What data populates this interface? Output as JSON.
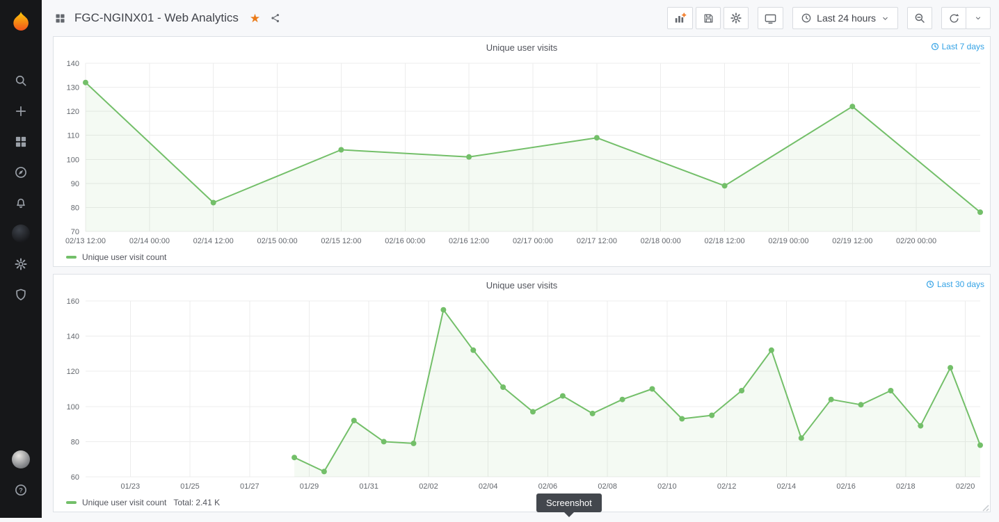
{
  "colors": {
    "accent_green": "#73bf69",
    "link_blue": "#33a2e5",
    "star_orange": "#eb7b18",
    "sidebar_bg": "#161719",
    "panel_bg": "#ffffff"
  },
  "sidebar": {
    "top_icons": [
      "grafana-logo",
      "search",
      "add",
      "dashboards",
      "explore-compass",
      "alerting-bell",
      "org-avatar",
      "configuration-gear",
      "server-admin-shield"
    ],
    "bottom_icons": [
      "user-avatar",
      "help"
    ]
  },
  "topbar": {
    "dashboard_icon": "apps",
    "title": "FGC-NGINX01 - Web Analytics",
    "star_icon": "star-filled",
    "share_icon": "share",
    "toolbar_icons": [
      "add-panel",
      "save",
      "settings-gear",
      "cycle-view-tv",
      "clock",
      "chevron-down",
      "zoom-out",
      "refresh"
    ],
    "time_picker_label": "Last 24 hours"
  },
  "tooltip": {
    "label": "Screenshot"
  },
  "chart_data": [
    {
      "type": "area",
      "title": "Unique user visits",
      "time_range_link": "Last 7 days",
      "legend_label": "Unique user visit count",
      "legend_total": "",
      "ylim": [
        70,
        140
      ],
      "y_ticks": [
        70,
        80,
        90,
        100,
        110,
        120,
        130,
        140
      ],
      "x_domain": [
        12,
        180
      ],
      "x_ticks": [
        "02/13 12:00",
        "02/14 00:00",
        "02/14 12:00",
        "02/15 00:00",
        "02/15 12:00",
        "02/16 00:00",
        "02/16 12:00",
        "02/17 00:00",
        "02/17 12:00",
        "02/18 00:00",
        "02/18 12:00",
        "02/19 00:00",
        "02/19 12:00",
        "02/20 00:00"
      ],
      "x_tick_pos": [
        12,
        24,
        36,
        48,
        60,
        72,
        84,
        96,
        108,
        120,
        132,
        144,
        156,
        168
      ],
      "point_dates": [
        "02/13 12:00",
        "02/14 12:00",
        "02/15 12:00",
        "02/16 12:00",
        "02/17 12:00",
        "02/18 12:00",
        "02/19 12:00",
        "02/20 12:00"
      ],
      "point_pos": [
        12,
        36,
        60,
        84,
        108,
        132,
        156,
        180
      ],
      "values": [
        132,
        82,
        104,
        101,
        109,
        89,
        122,
        78
      ],
      "grid": true,
      "legend_position": "bottom-left"
    },
    {
      "type": "area",
      "title": "Unique user visits",
      "time_range_link": "Last 30 days",
      "legend_label": "Unique user visit count",
      "legend_total": "Total: 2.41 K",
      "ylim": [
        60,
        160
      ],
      "y_ticks": [
        60,
        80,
        100,
        120,
        140,
        160
      ],
      "x_domain": [
        0.5,
        30.5
      ],
      "x_ticks": [
        "01/23",
        "01/25",
        "01/27",
        "01/29",
        "01/31",
        "02/02",
        "02/04",
        "02/06",
        "02/08",
        "02/10",
        "02/12",
        "02/14",
        "02/16",
        "02/18",
        "02/20"
      ],
      "x_tick_pos": [
        2,
        4,
        6,
        8,
        10,
        12,
        14,
        16,
        18,
        20,
        22,
        24,
        26,
        28,
        30
      ],
      "point_dates": [
        "01/28",
        "01/29",
        "01/30",
        "01/31",
        "02/01",
        "02/02",
        "02/03",
        "02/04",
        "02/05",
        "02/06",
        "02/07",
        "02/08",
        "02/09",
        "02/10",
        "02/11",
        "02/12",
        "02/13",
        "02/14",
        "02/15",
        "02/16",
        "02/17",
        "02/18",
        "02/19",
        "02/20"
      ],
      "point_pos": [
        7.5,
        8.5,
        9.5,
        10.5,
        11.5,
        12.5,
        13.5,
        14.5,
        15.5,
        16.5,
        17.5,
        18.5,
        19.5,
        20.5,
        21.5,
        22.5,
        23.5,
        24.5,
        25.5,
        26.5,
        27.5,
        28.5,
        29.5,
        30.5
      ],
      "values": [
        71,
        63,
        92,
        80,
        79,
        155,
        132,
        111,
        97,
        106,
        96,
        104,
        110,
        93,
        95,
        109,
        132,
        82,
        104,
        101,
        109,
        89,
        122,
        78
      ],
      "grid": true,
      "legend_position": "bottom-left"
    }
  ]
}
